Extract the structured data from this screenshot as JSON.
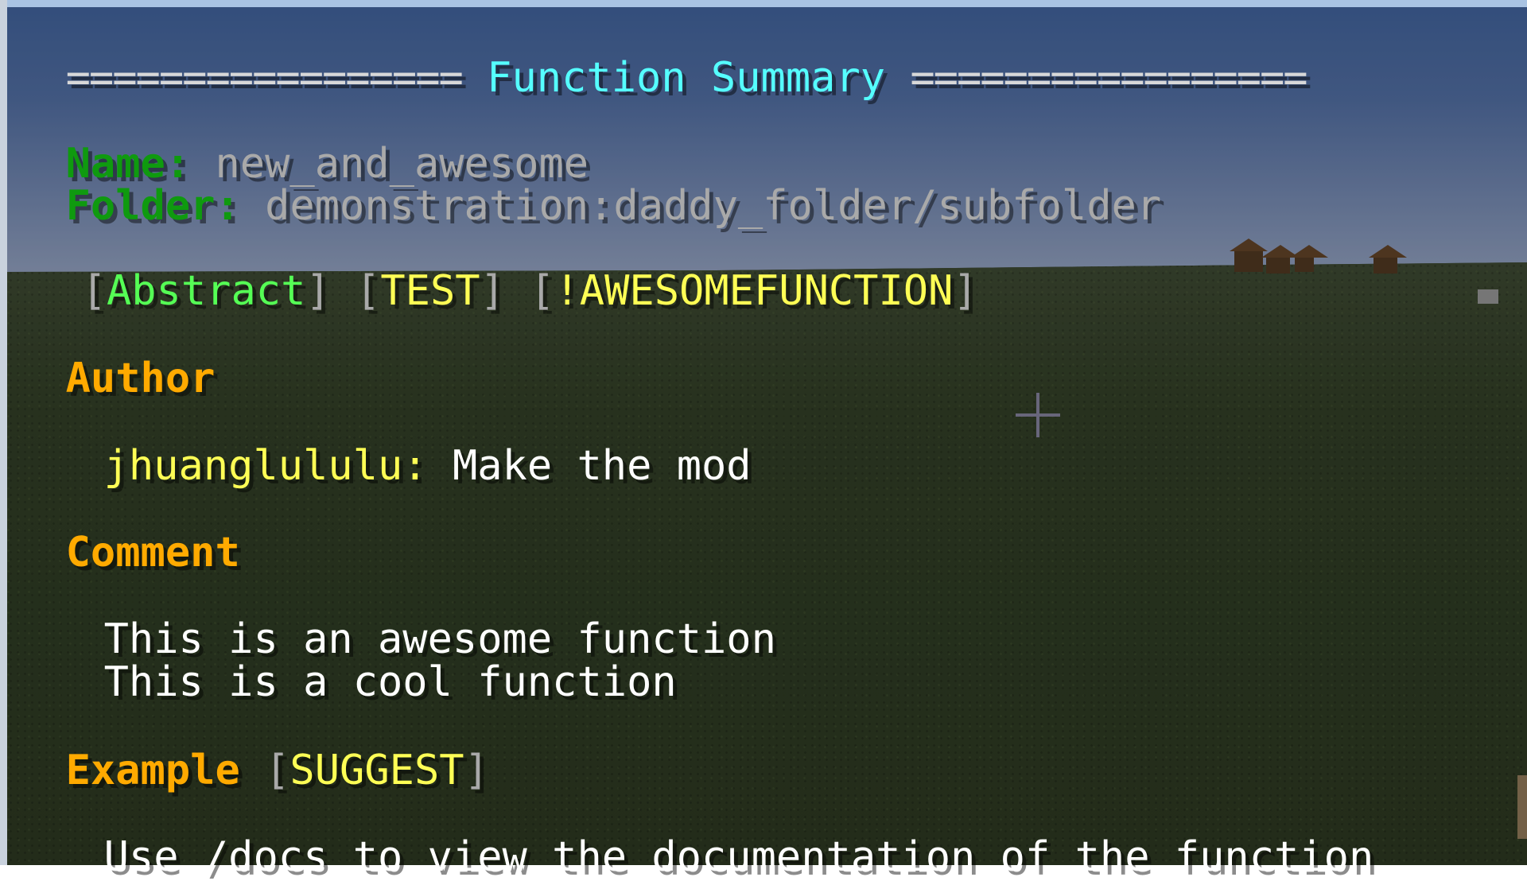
{
  "header": {
    "separator_left": "=================",
    "title": "Function Summary",
    "separator_right": "================="
  },
  "info": {
    "name_label": "Name:",
    "name_value": "new_and_awesome",
    "folder_label": "Folder:",
    "folder_value": "demonstration:daddy_folder/subfolder"
  },
  "tags": [
    {
      "label": "Abstract"
    },
    {
      "label": "TEST"
    },
    {
      "label": "!AWESOMEFUNCTION"
    }
  ],
  "sections": {
    "author": {
      "heading": "Author",
      "user": "jhuanglululu:",
      "text": "Make the mod"
    },
    "comment": {
      "heading": "Comment",
      "lines": [
        "This is an awesome function",
        "This is a cool function"
      ]
    },
    "example": {
      "heading": "Example",
      "suggest_label": "SUGGEST",
      "text": "Use /docs to view the documentation of the function"
    }
  },
  "brackets": {
    "open": "[",
    "close": "]"
  },
  "colors": {
    "label_green": "#0f9a0f",
    "tag_green": "#55ff55",
    "tag_yellow": "#ffff55",
    "heading_gold": "#ffaa00",
    "title_aqua": "#55ffff",
    "value_gray": "#a9a9a9"
  },
  "icons": {
    "crosshair": "crosshair-icon"
  }
}
